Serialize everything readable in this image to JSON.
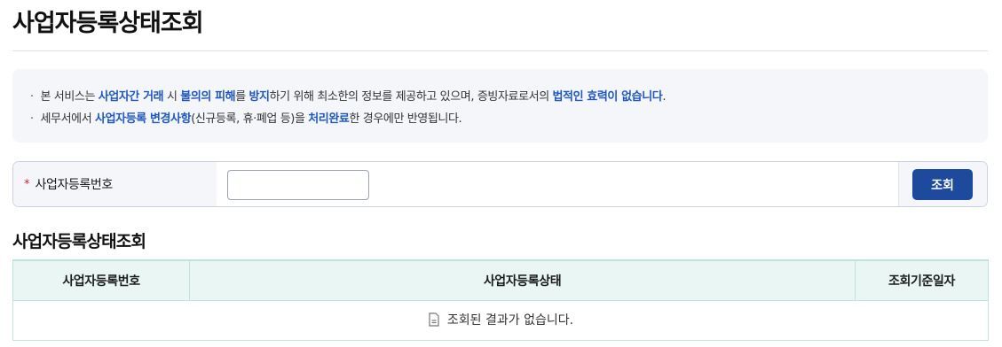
{
  "page": {
    "title": "사업자등록상태조회"
  },
  "notice": {
    "line1": [
      {
        "text": "본 서비스는 ",
        "hl": false
      },
      {
        "text": "사업자간 거래",
        "hl": true
      },
      {
        "text": " 시 ",
        "hl": false
      },
      {
        "text": "불의의 피해",
        "hl": true
      },
      {
        "text": "를 ",
        "hl": false
      },
      {
        "text": "방지",
        "hl": true
      },
      {
        "text": "하기 위해 최소한의 정보를 제공하고 있으며, 증빙자료로서의 ",
        "hl": false
      },
      {
        "text": "법적인 효력이 없습니다",
        "hl": true
      },
      {
        "text": ".",
        "hl": false
      }
    ],
    "line2": [
      {
        "text": "세무서에서 ",
        "hl": false
      },
      {
        "text": "사업자등록 변경사항",
        "hl": true
      },
      {
        "text": "(신규등록, 휴·폐업 등)을 ",
        "hl": false
      },
      {
        "text": "처리완료",
        "hl": true
      },
      {
        "text": "한 경우에만 반영됩니다.",
        "hl": false
      }
    ],
    "bullet": "·"
  },
  "search": {
    "required_mark": "*",
    "label": "사업자등록번호",
    "input_value": "",
    "input_placeholder": "",
    "button_label": "조회"
  },
  "results": {
    "section_title": "사업자등록상태조회",
    "columns": [
      "사업자등록번호",
      "사업자등록상태",
      "조회기준일자"
    ],
    "empty_message": "조회된 결과가 없습니다."
  },
  "colors": {
    "accent": "#1f57c2",
    "button": "#1d4a9c",
    "required": "#d1203b",
    "table_header_bg": "#e9f6f4"
  },
  "icons": {
    "empty_result": "document-icon"
  }
}
